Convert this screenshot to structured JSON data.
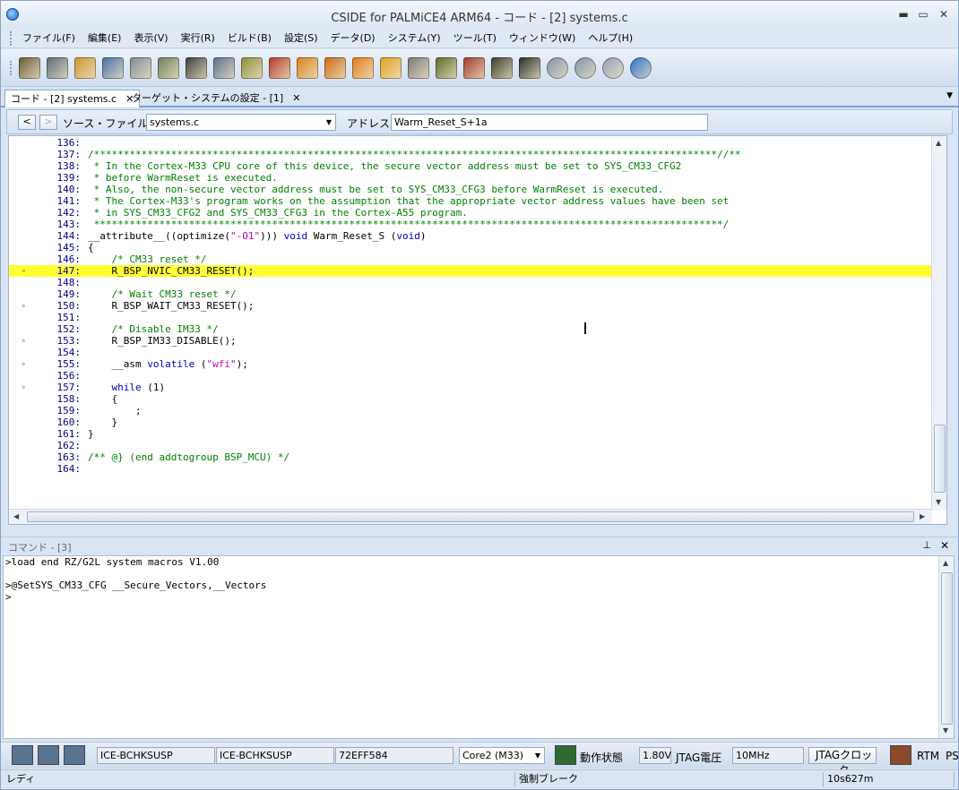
{
  "window": {
    "title": "CSIDE for PALMiCE4 ARM64 - コード - [2] systems.c"
  },
  "menu": [
    "ファイル(F)",
    "編集(E)",
    "表示(V)",
    "実行(R)",
    "ビルド(B)",
    "設定(S)",
    "データ(D)",
    "システム(Y)",
    "ツール(T)",
    "ウィンドウ(W)",
    "ヘルプ(H)"
  ],
  "toolbar_icons": [
    "open-folder-icon",
    "open-project-icon",
    "folder-icon",
    "source-list-icon",
    "document-icon",
    "register-icon",
    "memory-icon",
    "watch-icon",
    "breakpoint-icon",
    "break-icon",
    "step-in-icon",
    "step-over-icon",
    "step-out-icon",
    "run-icon",
    "trace-icon",
    "chip-icon",
    "chip-red-icon",
    "bus-icon",
    "camera-icon",
    "cloud-icon",
    "cloud-edit-icon",
    "cloud-sync-icon",
    "refresh-icon"
  ],
  "tabs": [
    {
      "label": "コード - [2] systems.c",
      "active": true
    },
    {
      "label": "ターゲット・システムの設定 - [1]",
      "active": false
    }
  ],
  "address_bar": {
    "source_label": "ソース・ファイル",
    "source_value": "systems.c",
    "address_label": "アドレス",
    "address_value": "Warm_Reset_S+1a"
  },
  "code_lines": [
    {
      "n": "136:",
      "t": "",
      "bp": false,
      "hl": false,
      "cls": ""
    },
    {
      "n": "137:",
      "t": "/*********************************************************************************************************//**",
      "bp": false,
      "hl": false,
      "cls": "comment"
    },
    {
      "n": "138:",
      "t": " * In the Cortex-M33 CPU core of this device, the secure vector address must be set to SYS_CM33_CFG2",
      "bp": false,
      "hl": false,
      "cls": "comment"
    },
    {
      "n": "139:",
      "t": " * before WarmReset is executed.",
      "bp": false,
      "hl": false,
      "cls": "comment"
    },
    {
      "n": "140:",
      "t": " * Also, the non-secure vector address must be set to SYS_CM33_CFG3 before WarmReset is executed.",
      "bp": false,
      "hl": false,
      "cls": "comment"
    },
    {
      "n": "141:",
      "t": " * The Cortex-M33's program works on the assumption that the appropriate vector address values have been set",
      "bp": false,
      "hl": false,
      "cls": "comment"
    },
    {
      "n": "142:",
      "t": " * in SYS_CM33_CFG2 and SYS_CM33_CFG3 in the Cortex-A55 program.",
      "bp": false,
      "hl": false,
      "cls": "comment"
    },
    {
      "n": "143:",
      "t": " **********************************************************************************************************/",
      "bp": false,
      "hl": false,
      "cls": "comment"
    },
    {
      "n": "144:",
      "t": "__attribute__((optimize(\"-O1\"))) void Warm_Reset_S (void)",
      "bp": false,
      "hl": false,
      "cls": "attr"
    },
    {
      "n": "145:",
      "t": "{",
      "bp": false,
      "hl": false,
      "cls": ""
    },
    {
      "n": "146:",
      "t": "    /* CM33 reset */",
      "bp": false,
      "hl": false,
      "cls": "comment"
    },
    {
      "n": "147:",
      "t": "    R_BSP_NVIC_CM33_RESET();",
      "bp": true,
      "hl": true,
      "cls": ""
    },
    {
      "n": "148:",
      "t": "",
      "bp": false,
      "hl": false,
      "cls": ""
    },
    {
      "n": "149:",
      "t": "    /* Wait CM33 reset */",
      "bp": false,
      "hl": false,
      "cls": "comment"
    },
    {
      "n": "150:",
      "t": "    R_BSP_WAIT_CM33_RESET();",
      "bp": true,
      "hl": false,
      "cls": ""
    },
    {
      "n": "151:",
      "t": "",
      "bp": false,
      "hl": false,
      "cls": ""
    },
    {
      "n": "152:",
      "t": "    /* Disable IM33 */",
      "bp": false,
      "hl": false,
      "cls": "comment"
    },
    {
      "n": "153:",
      "t": "    R_BSP_IM33_DISABLE();",
      "bp": true,
      "hl": false,
      "cls": ""
    },
    {
      "n": "154:",
      "t": "",
      "bp": false,
      "hl": false,
      "cls": ""
    },
    {
      "n": "155:",
      "t": "    __asm volatile (\"wfi\");",
      "bp": true,
      "hl": false,
      "cls": "asm"
    },
    {
      "n": "156:",
      "t": "",
      "bp": false,
      "hl": false,
      "cls": ""
    },
    {
      "n": "157:",
      "t": "    while (1)",
      "bp": true,
      "hl": false,
      "cls": "while"
    },
    {
      "n": "158:",
      "t": "    {",
      "bp": false,
      "hl": false,
      "cls": ""
    },
    {
      "n": "159:",
      "t": "        ;",
      "bp": false,
      "hl": false,
      "cls": ""
    },
    {
      "n": "160:",
      "t": "    }",
      "bp": false,
      "hl": false,
      "cls": ""
    },
    {
      "n": "161:",
      "t": "}",
      "bp": false,
      "hl": false,
      "cls": ""
    },
    {
      "n": "162:",
      "t": "",
      "bp": false,
      "hl": false,
      "cls": ""
    },
    {
      "n": "163:",
      "t": "/** @} (end addtogroup BSP_MCU) */",
      "bp": false,
      "hl": false,
      "cls": "comment"
    },
    {
      "n": "164:",
      "t": "",
      "bp": false,
      "hl": false,
      "cls": ""
    }
  ],
  "command_pane": {
    "title": "コマンド - [3]",
    "lines": [
      ">load end RZ/G2L system macros V1.00",
      "",
      ">@SetSYS_CM33_CFG __Secure_Vectors,__Vectors",
      ">"
    ]
  },
  "status": {
    "ice1": "ICE-BCHKSUSP",
    "ice2": "ICE-BCHKSUSP",
    "serial": "72EFF584",
    "core": "Core2 (M33)",
    "state_label": "動作状態",
    "voltage": "1.80V",
    "voltage_label": "JTAG電圧",
    "clock": "10MHz",
    "clock_button": "JTAGクロック",
    "rtm": "RTM",
    "ps": "PS"
  },
  "status2": {
    "ready": "レディ",
    "break": "強制ブレーク",
    "time": "10s627m"
  }
}
